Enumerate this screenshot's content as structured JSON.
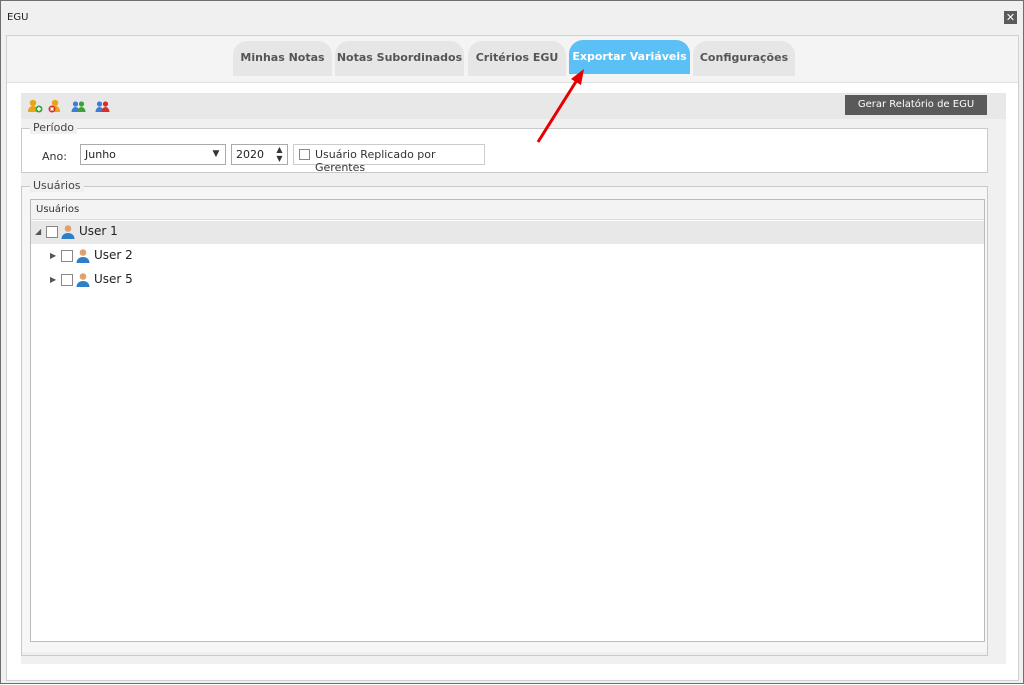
{
  "window": {
    "title": "EGU"
  },
  "tabs": [
    {
      "label": "Minhas Notas"
    },
    {
      "label": "Notas Subordinados"
    },
    {
      "label": "Critérios EGU"
    },
    {
      "label": "Exportar Variáveis"
    },
    {
      "label": "Configurações"
    }
  ],
  "toolbar": {
    "report_button": "Gerar Relatório de EGU"
  },
  "periodo": {
    "legend": "Período",
    "year_label": "Ano:",
    "month_value": "Junho",
    "year_value": "2020",
    "replicated_label": "Usuário Replicado por Gerentes"
  },
  "usuarios": {
    "legend": "Usuários",
    "column_header": "Usuários",
    "rows": [
      {
        "name": "User 1"
      },
      {
        "name": "User 2"
      },
      {
        "name": "User 5"
      }
    ]
  },
  "colors": {
    "active_tab": "#5bc0f5",
    "arrow": "#e60000"
  }
}
